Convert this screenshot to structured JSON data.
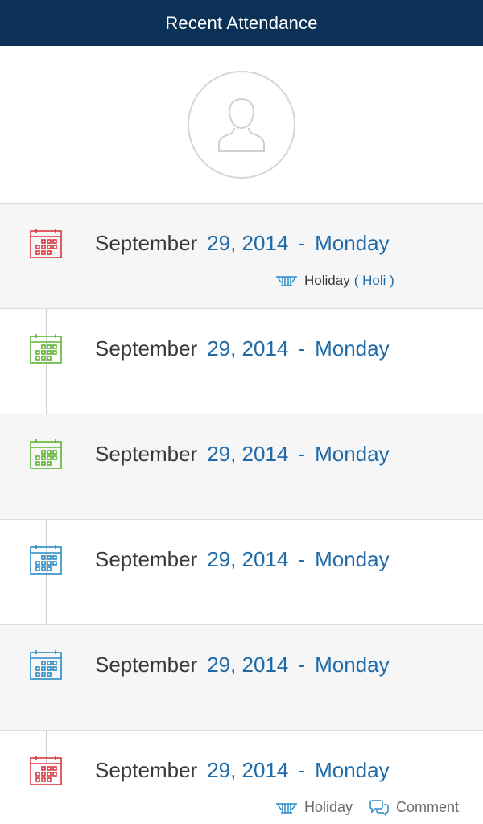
{
  "header": {
    "title": "Recent Attendance"
  },
  "colors": {
    "header_bg": "#0c3156",
    "red": "#d9363e",
    "green": "#5bb630",
    "blue": "#2a8bc7",
    "accent": "#1f6aa8"
  },
  "entries": [
    {
      "month": "September",
      "day": "29, 2014",
      "sep": "-",
      "weekday": "Monday",
      "status_color": "red",
      "note": {
        "icon": "holiday-icon",
        "label": "Holiday",
        "name": "( Holi )"
      }
    },
    {
      "month": "September",
      "day": "29, 2014",
      "sep": "-",
      "weekday": "Monday",
      "status_color": "green"
    },
    {
      "month": "September",
      "day": "29, 2014",
      "sep": "-",
      "weekday": "Monday",
      "status_color": "green"
    },
    {
      "month": "September",
      "day": "29, 2014",
      "sep": "-",
      "weekday": "Monday",
      "status_color": "blue"
    },
    {
      "month": "September",
      "day": "29, 2014",
      "sep": "-",
      "weekday": "Monday",
      "status_color": "blue"
    },
    {
      "month": "September",
      "day": "29, 2014",
      "sep": "-",
      "weekday": "Monday",
      "status_color": "red"
    }
  ],
  "legend": {
    "holiday": {
      "icon": "holiday-icon",
      "label": "Holiday"
    },
    "comment": {
      "icon": "comment-icon",
      "label": "Comment"
    }
  }
}
